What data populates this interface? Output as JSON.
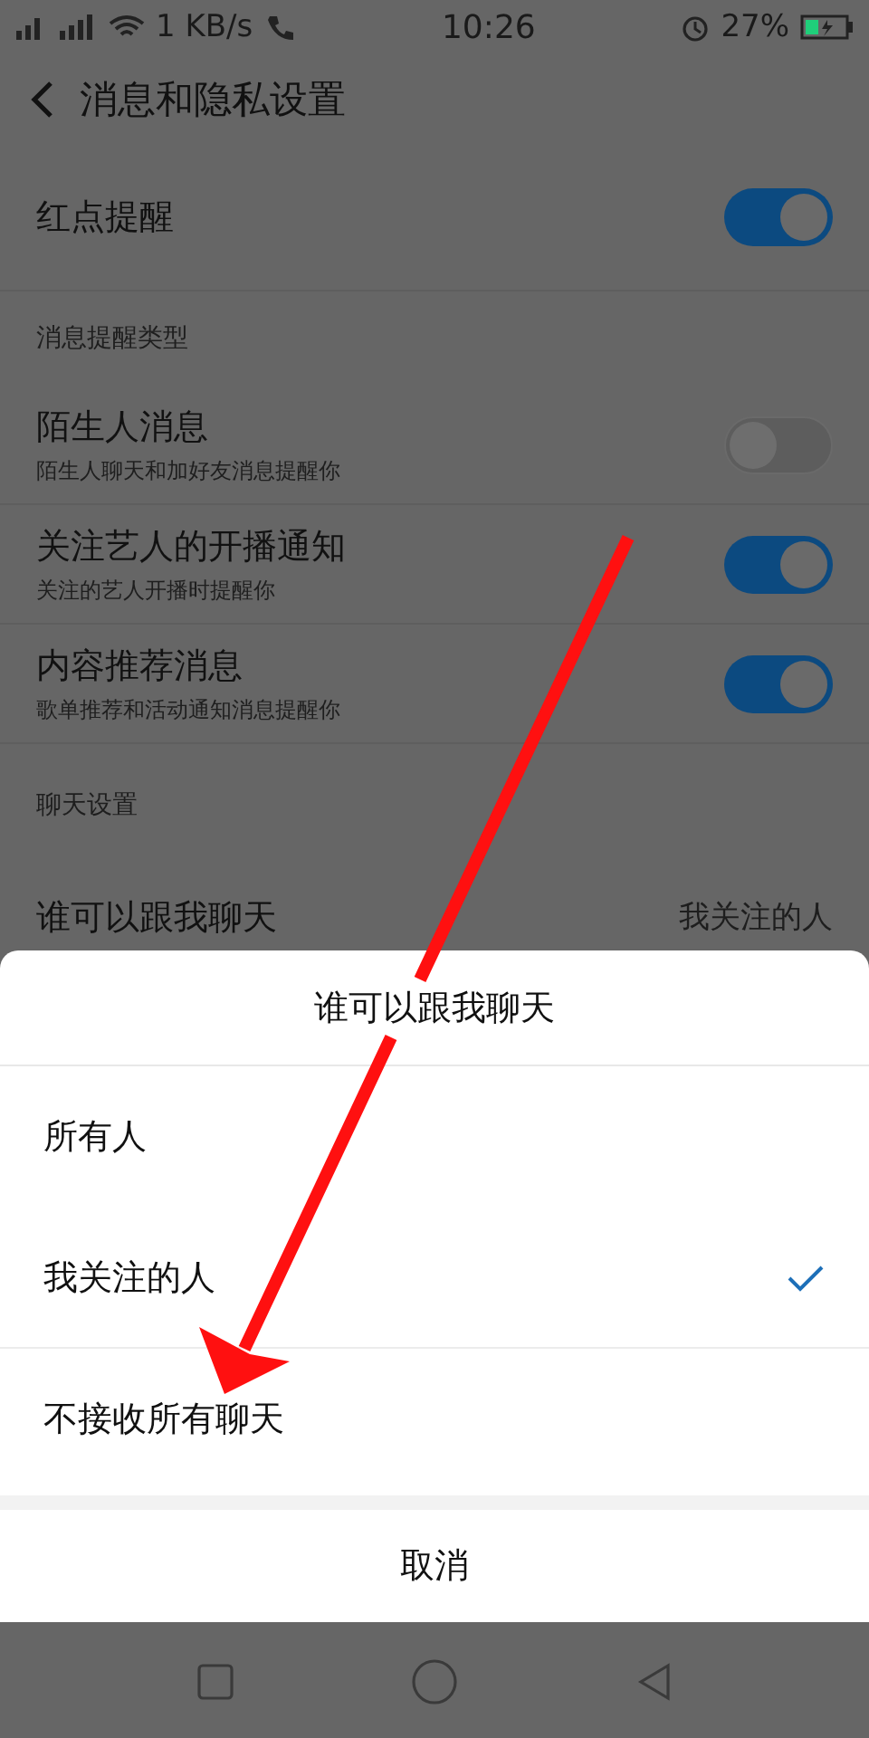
{
  "status_bar": {
    "speed": "1 KB/s",
    "time": "10:26",
    "battery": "27%"
  },
  "header": {
    "title": "消息和隐私设置"
  },
  "sections": [
    {
      "rows": [
        {
          "kind": "toggle",
          "label": "红点提醒",
          "on": true
        }
      ]
    },
    {
      "title": "消息提醒类型",
      "rows": [
        {
          "kind": "toggle",
          "label": "陌生人消息",
          "subtitle": "陌生人聊天和加好友消息提醒你",
          "on": false
        },
        {
          "kind": "toggle",
          "label": "关注艺人的开播通知",
          "subtitle": "关注的艺人开播时提醒你",
          "on": true
        },
        {
          "kind": "toggle",
          "label": "内容推荐消息",
          "subtitle": "歌单推荐和活动通知消息提醒你",
          "on": true
        }
      ]
    },
    {
      "title": "聊天设置",
      "rows": [
        {
          "kind": "value",
          "label": "谁可以跟我聊天",
          "value": "我关注的人"
        }
      ]
    }
  ],
  "sheet": {
    "title": "谁可以跟我聊天",
    "options": [
      {
        "label": "所有人",
        "selected": false
      },
      {
        "label": "我关注的人",
        "selected": true
      },
      {
        "label": "不接收所有聊天",
        "selected": false
      }
    ],
    "cancel": "取消"
  }
}
